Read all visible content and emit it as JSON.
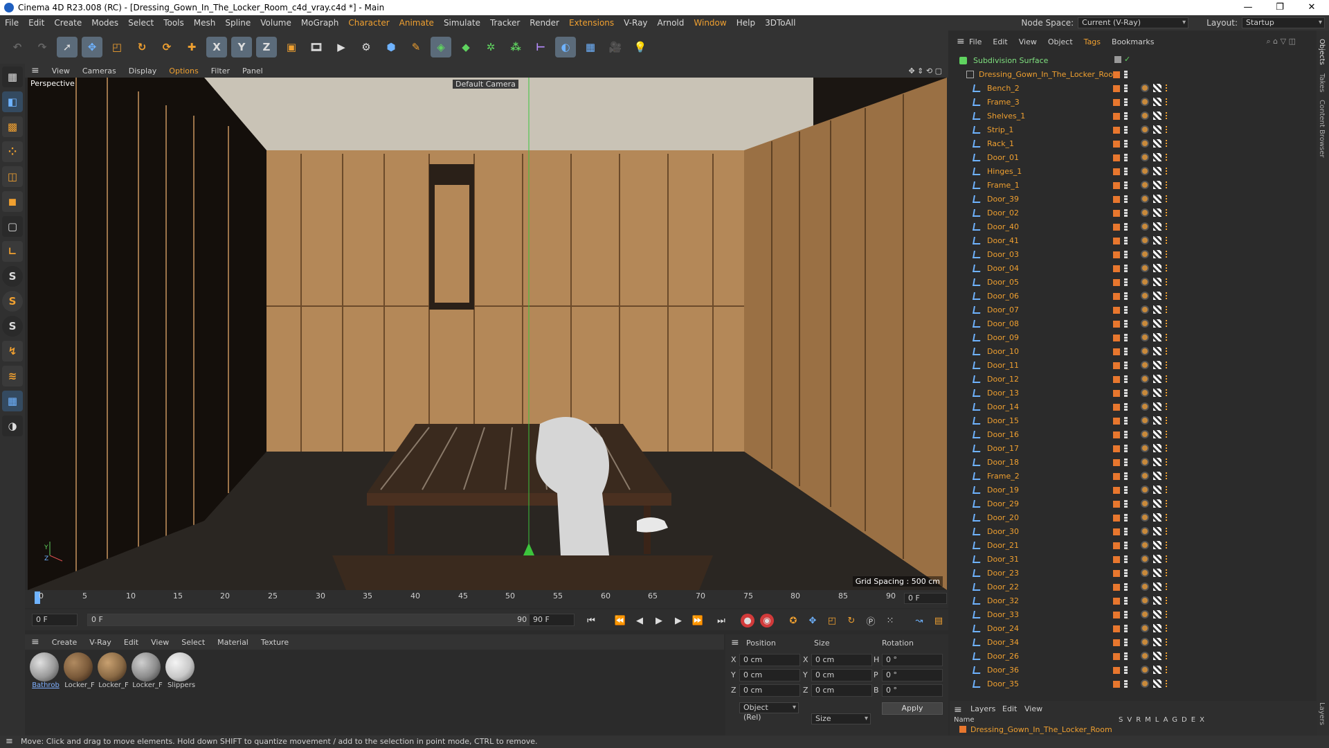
{
  "window": {
    "title": "Cinema 4D R23.008 (RC) - [Dressing_Gown_In_The_Locker_Room_c4d_vray.c4d *] - Main",
    "controls": [
      "—",
      "❐",
      "✕"
    ]
  },
  "menubar": {
    "items": [
      "File",
      "Edit",
      "Create",
      "Modes",
      "Select",
      "Tools",
      "Mesh",
      "Spline",
      "Volume",
      "MoGraph",
      "Character",
      "Animate",
      "Simulate",
      "Tracker",
      "Render",
      "Extensions",
      "V-Ray",
      "Arnold",
      "Window",
      "Help",
      "3DToAll"
    ],
    "node_space_label": "Node Space:",
    "node_space_value": "Current (V-Ray)",
    "layout_label": "Layout:",
    "layout_value": "Startup"
  },
  "toolbar": {
    "axis_x": "X",
    "axis_y": "Y",
    "axis_z": "Z"
  },
  "viewport": {
    "menu": [
      "View",
      "Cameras",
      "Display",
      "Options",
      "Filter",
      "Panel"
    ],
    "view_name": "Perspective",
    "camera": "Default Camera",
    "grid_spacing": "Grid Spacing : 500 cm",
    "axis_y": "Y",
    "axis_z": "Z"
  },
  "timeline": {
    "ticks": [
      "0",
      "5",
      "10",
      "15",
      "20",
      "25",
      "30",
      "35",
      "40",
      "45",
      "50",
      "55",
      "60",
      "65",
      "70",
      "75",
      "80",
      "85",
      "90"
    ],
    "current_frame": "0 F",
    "start_frame": "0 F",
    "range_start": "0 F",
    "range_end": "90 F",
    "end_frame": "90 F"
  },
  "materials": {
    "menu": [
      "Create",
      "V-Ray",
      "Edit",
      "View",
      "Select",
      "Material",
      "Texture"
    ],
    "items": [
      {
        "name": "Bathrob",
        "color": "#9a9a9a"
      },
      {
        "name": "Locker_F",
        "color": "#7a5a3a"
      },
      {
        "name": "Locker_F",
        "color": "#8a6a45"
      },
      {
        "name": "Locker_F",
        "color": "#8c8c8c"
      },
      {
        "name": "Slippers",
        "color": "#c8c8c8"
      }
    ]
  },
  "coordinates": {
    "headers": [
      "Position",
      "Size",
      "Rotation"
    ],
    "rows": [
      {
        "axis": "X",
        "pos": "0 cm",
        "size_axis": "X",
        "size": "0 cm",
        "rot_axis": "H",
        "rot": "0 °"
      },
      {
        "axis": "Y",
        "pos": "0 cm",
        "size_axis": "Y",
        "size": "0 cm",
        "rot_axis": "P",
        "rot": "0 °"
      },
      {
        "axis": "Z",
        "pos": "0 cm",
        "size_axis": "Z",
        "size": "0 cm",
        "rot_axis": "B",
        "rot": "0 °"
      }
    ],
    "mode": "Object (Rel)",
    "size_mode": "Size",
    "apply": "Apply"
  },
  "object_manager": {
    "menu": [
      "File",
      "Edit",
      "View",
      "Object",
      "Tags",
      "Bookmarks"
    ],
    "root": "Subdivision Surface",
    "group": "Dressing_Gown_In_The_Locker_Room",
    "objects": [
      "Bench_2",
      "Frame_3",
      "Shelves_1",
      "Strip_1",
      "Rack_1",
      "Door_01",
      "Hinges_1",
      "Frame_1",
      "Door_39",
      "Door_02",
      "Door_40",
      "Door_41",
      "Door_03",
      "Door_04",
      "Door_05",
      "Door_06",
      "Door_07",
      "Door_08",
      "Door_09",
      "Door_10",
      "Door_11",
      "Door_12",
      "Door_13",
      "Door_14",
      "Door_15",
      "Door_16",
      "Door_17",
      "Door_18",
      "Frame_2",
      "Door_19",
      "Door_29",
      "Door_20",
      "Door_30",
      "Door_21",
      "Door_31",
      "Door_23",
      "Door_22",
      "Door_32",
      "Door_33",
      "Door_24",
      "Door_34",
      "Door_26",
      "Door_36",
      "Door_35"
    ]
  },
  "side_tabs": [
    "Objects",
    "Takes",
    "Content Browser",
    "Layers"
  ],
  "layers": {
    "menu": [
      "Layers",
      "Edit",
      "View"
    ],
    "name_header": "Name",
    "flags": [
      "S",
      "V",
      "R",
      "M",
      "L",
      "A",
      "G",
      "D",
      "E",
      "X"
    ],
    "entry": "Dressing_Gown_In_The_Locker_Room"
  },
  "status": "Move: Click and drag to move elements. Hold down SHIFT to quantize movement / add to the selection in point mode, CTRL to remove."
}
